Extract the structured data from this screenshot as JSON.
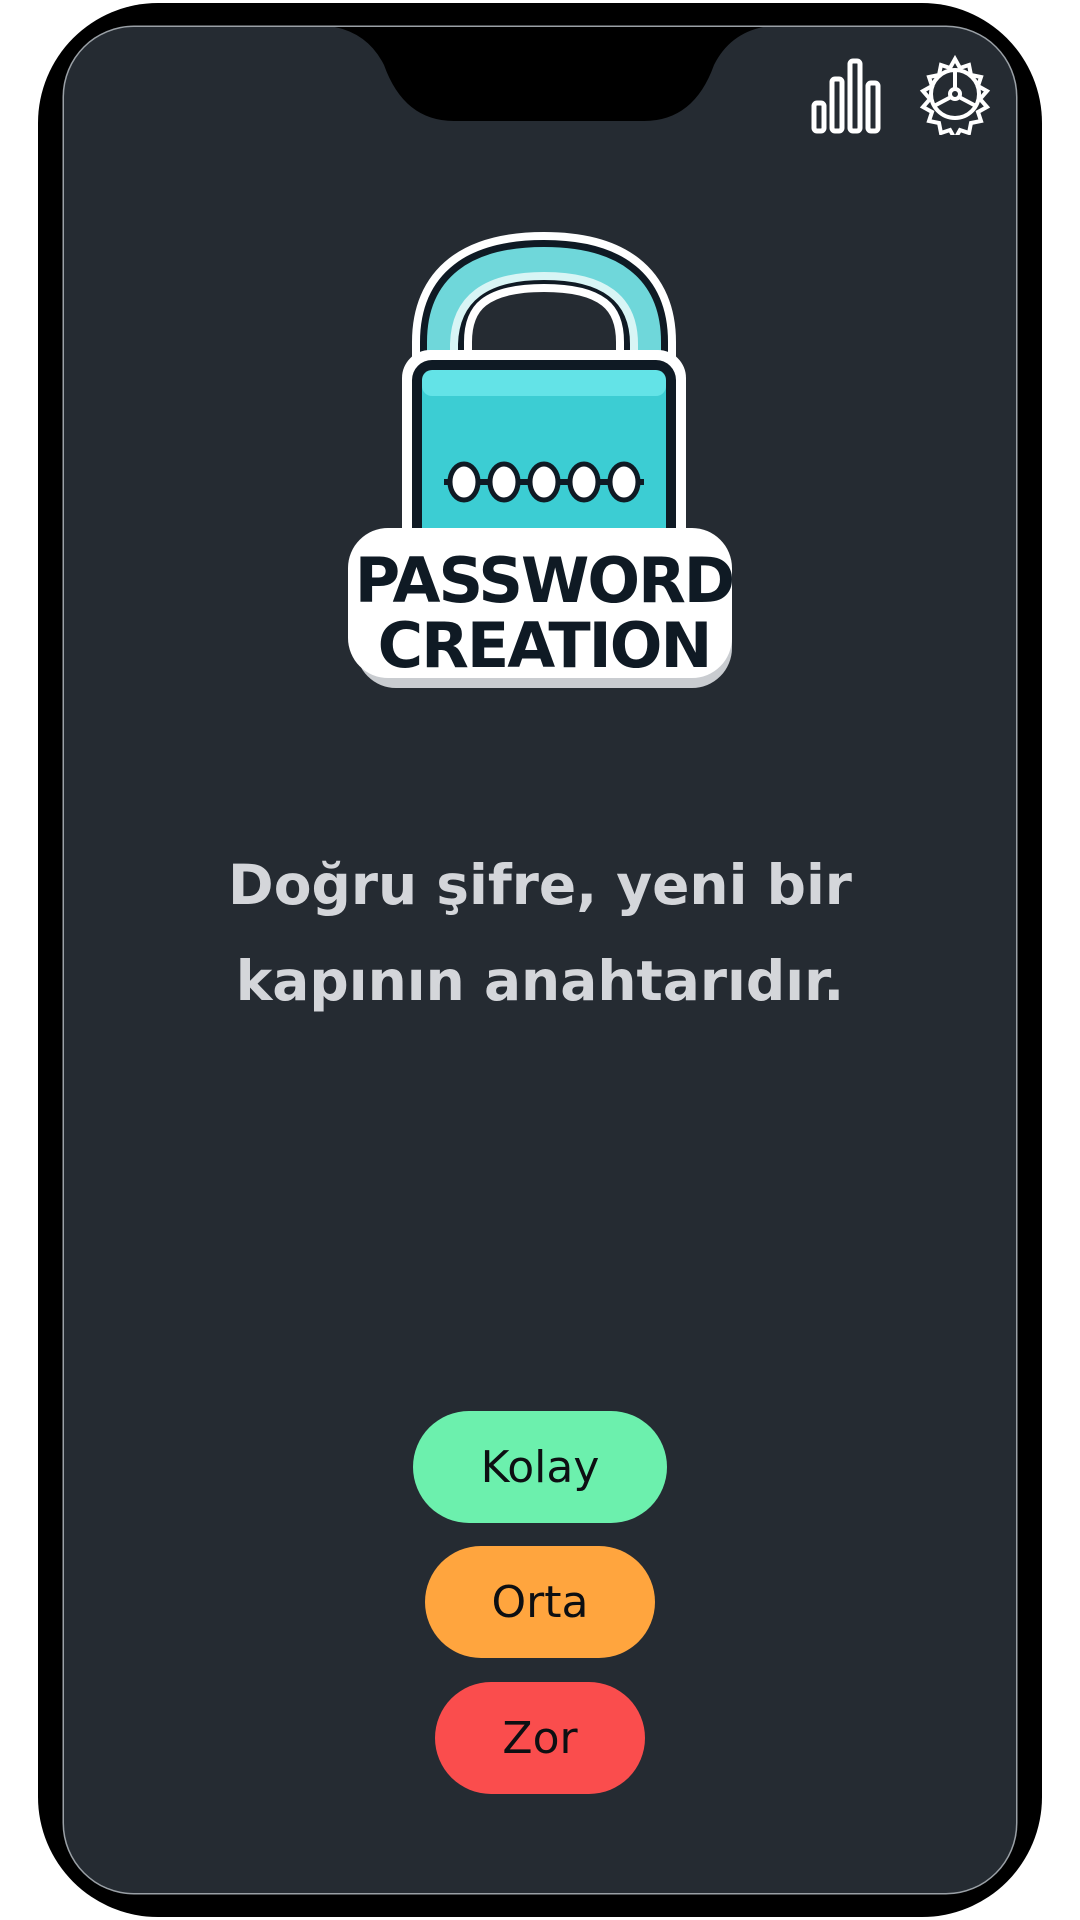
{
  "colors": {
    "screen_background": "#252b32",
    "text": "#d4d6da",
    "lock_teal": "#40d0d4",
    "easy": "#6cf0ad",
    "medium": "#ffa53e",
    "hard": "#fa4d4d"
  },
  "top_bar": {
    "stats_icon": "bar-chart-icon",
    "settings_icon": "gear-icon"
  },
  "logo": {
    "line1": "PASSWORD",
    "line2": "CREATION",
    "icon": "padlock-icon"
  },
  "quote": "Doğru şifre, yeni bir kapının anahtarıdır.",
  "difficulty": {
    "easy": "Kolay",
    "medium": "Orta",
    "hard": "Zor"
  }
}
